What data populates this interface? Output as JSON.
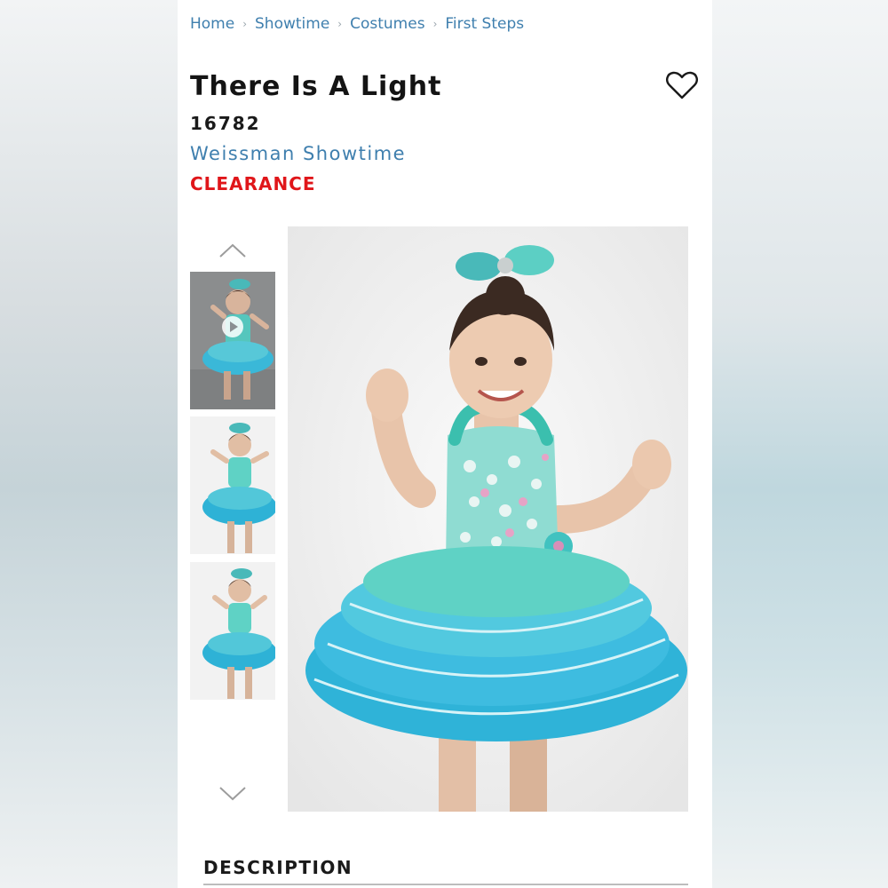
{
  "breadcrumb": [
    "Home",
    "Showtime",
    "Costumes",
    "First Steps"
  ],
  "product": {
    "title": "There Is A Light",
    "sku": "16782",
    "brand": "Weissman Showtime",
    "badge": "CLEARANCE"
  },
  "gallery": {
    "thumbnails": [
      {
        "kind": "video"
      },
      {
        "kind": "image"
      },
      {
        "kind": "image"
      }
    ],
    "icons": {
      "up": "chevron-up-icon",
      "down": "chevron-down-icon",
      "play": "play-icon",
      "favorite": "heart-icon"
    }
  },
  "sections": {
    "description": "DESCRIPTION"
  },
  "colors": {
    "link": "#3f7fae",
    "clearance": "#e0161a",
    "costume_teal": "#33b9d6",
    "costume_mint": "#5fd2c5"
  }
}
